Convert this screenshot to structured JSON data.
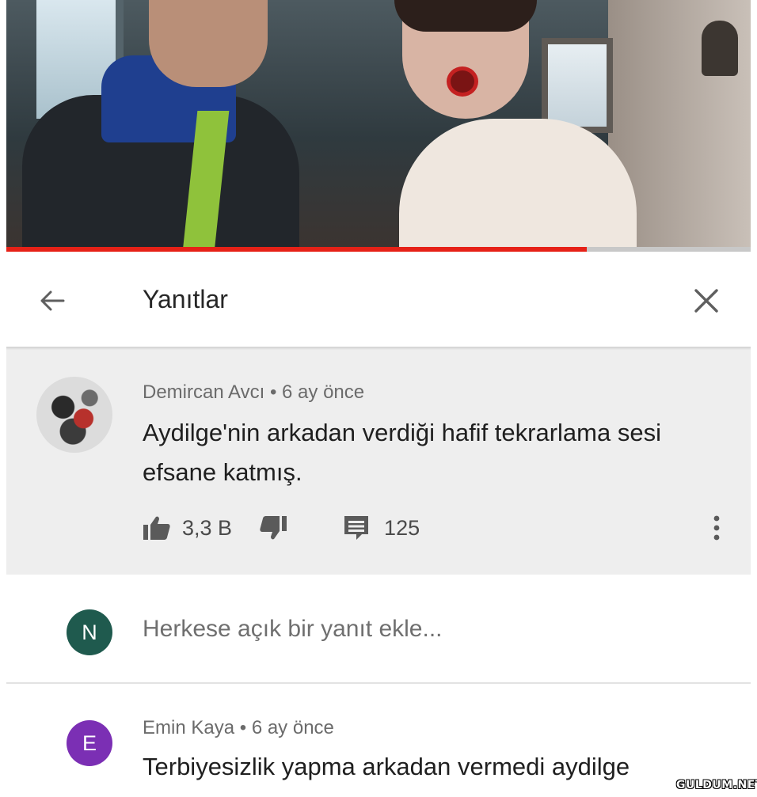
{
  "video": {
    "progress": 0.78,
    "progress_color": "#e62117"
  },
  "header": {
    "title": "Yanıtlar",
    "back_icon": "arrow-left-icon",
    "close_icon": "close-icon"
  },
  "main_comment": {
    "author": "Demircan Avcı",
    "separator": "•",
    "time": "6 ay önce",
    "text": "Aydilge'nin arkadan verdiği hafif tekrarlama sesi efsane katmış.",
    "like_count": "3,3 B",
    "reply_count": "125",
    "icons": [
      "thumb-up-icon",
      "thumb-down-icon",
      "comment-icon",
      "more-vert-icon"
    ],
    "background": "#eeeeee"
  },
  "add_reply": {
    "avatar_letter": "N",
    "avatar_color": "#1f5a4e",
    "placeholder": "Herkese açık bir yanıt ekle..."
  },
  "second_comment": {
    "avatar_letter": "E",
    "avatar_color": "#7b2fb4",
    "author": "Emin Kaya",
    "separator": "•",
    "time": "6 ay önce",
    "text": "Terbiyesizlik yapma arkadan vermedi aydilge"
  },
  "watermark": "GULDUM.NET"
}
